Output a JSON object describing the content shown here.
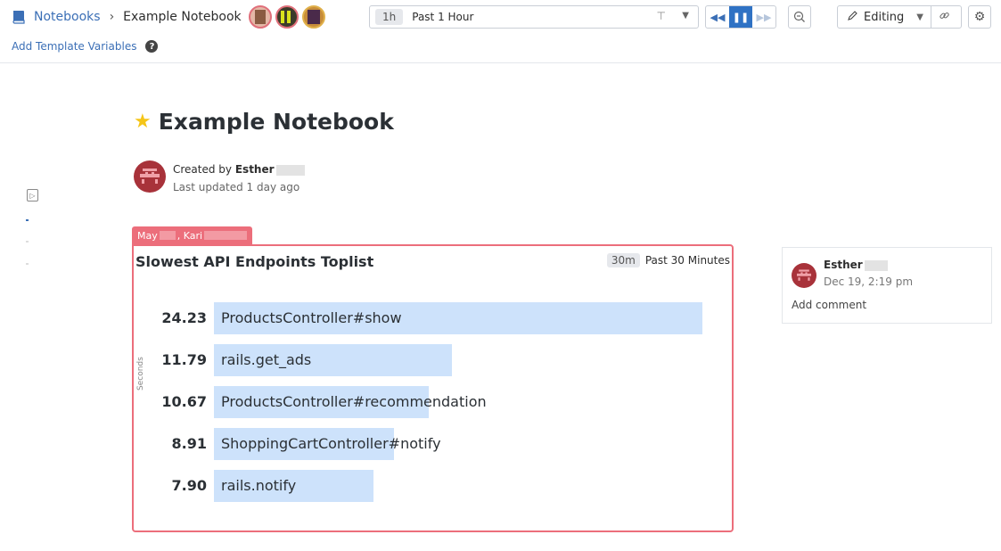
{
  "header": {
    "breadcrumb_root": "Notebooks",
    "breadcrumb_sep": "›",
    "notebook_name": "Example Notebook"
  },
  "time": {
    "shortcut": "1h",
    "label": "Past 1 Hour"
  },
  "mode": {
    "label": "Editing"
  },
  "template_variables": {
    "label": "Add Template Variables"
  },
  "notebook": {
    "title": "Example Notebook",
    "created_by_prefix": "Created by",
    "created_by_name": "Esther",
    "last_updated": "Last updated 1 day ago"
  },
  "cell": {
    "tag_name_1": "May",
    "tag_name_2": ", Kari",
    "title": "Slowest API Endpoints Toplist",
    "time_shortcut": "30m",
    "time_label": "Past 30 Minutes",
    "y_axis_label": "Seconds"
  },
  "chart_data": {
    "type": "bar",
    "title": "Slowest API Endpoints Toplist",
    "ylabel": "Seconds",
    "categories": [
      "ProductsController#show",
      "rails.get_ads",
      "ProductsController#recommendation",
      "ShoppingCartController#notify",
      "rails.notify"
    ],
    "values": [
      24.23,
      11.79,
      10.67,
      8.91,
      7.9
    ],
    "value_labels": [
      "24.23",
      "11.79",
      "10.67",
      "8.91",
      "7.90"
    ],
    "bar_color": "#cde2fb"
  },
  "comment": {
    "author": "Esther",
    "date": "Dec 19, 2:19 pm",
    "add_label": "Add comment"
  },
  "colors": {
    "accent": "#3b6fb6",
    "highlight": "#ec6e7b",
    "star": "#f5c518"
  }
}
